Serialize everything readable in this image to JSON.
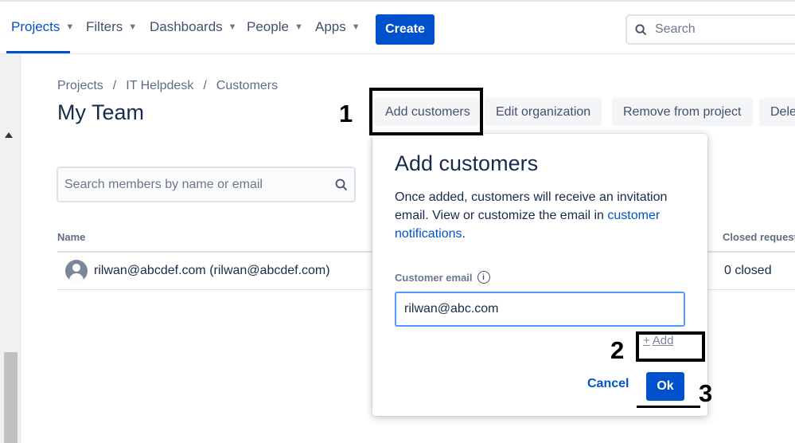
{
  "nav": {
    "items": [
      {
        "label": "Projects",
        "active": true
      },
      {
        "label": "Filters"
      },
      {
        "label": "Dashboards"
      },
      {
        "label": "People"
      },
      {
        "label": "Apps"
      }
    ],
    "create_label": "Create",
    "search_placeholder": "Search"
  },
  "breadcrumb": [
    "Projects",
    "IT Helpdesk",
    "Customers"
  ],
  "page_title": "My Team",
  "actions": {
    "add_customers": "Add customers",
    "edit_organization": "Edit organization",
    "remove_from_project": "Remove from project",
    "delete": "Dele"
  },
  "member_search_placeholder": "Search members by name or email",
  "table": {
    "columns": {
      "name": "Name",
      "closed": "Closed request"
    },
    "rows": [
      {
        "member": "rilwan@abcdef.com (rilwan@abcdef.com)",
        "closed": "0 closed"
      }
    ]
  },
  "dialog": {
    "title": "Add customers",
    "desc_prefix": "Once added, customers will receive an invitation email. View or customize the email in ",
    "desc_link": "customer notifications",
    "desc_suffix": ".",
    "email_label": "Customer email",
    "email_value": "rilwan@abc.com",
    "add_label": "Add",
    "cancel_label": "Cancel",
    "ok_label": "Ok"
  },
  "annotations": [
    "1",
    "2",
    "3"
  ],
  "colors": {
    "accent": "#0052CC",
    "text": "#172B4D",
    "subtle": "#5E6C84"
  }
}
